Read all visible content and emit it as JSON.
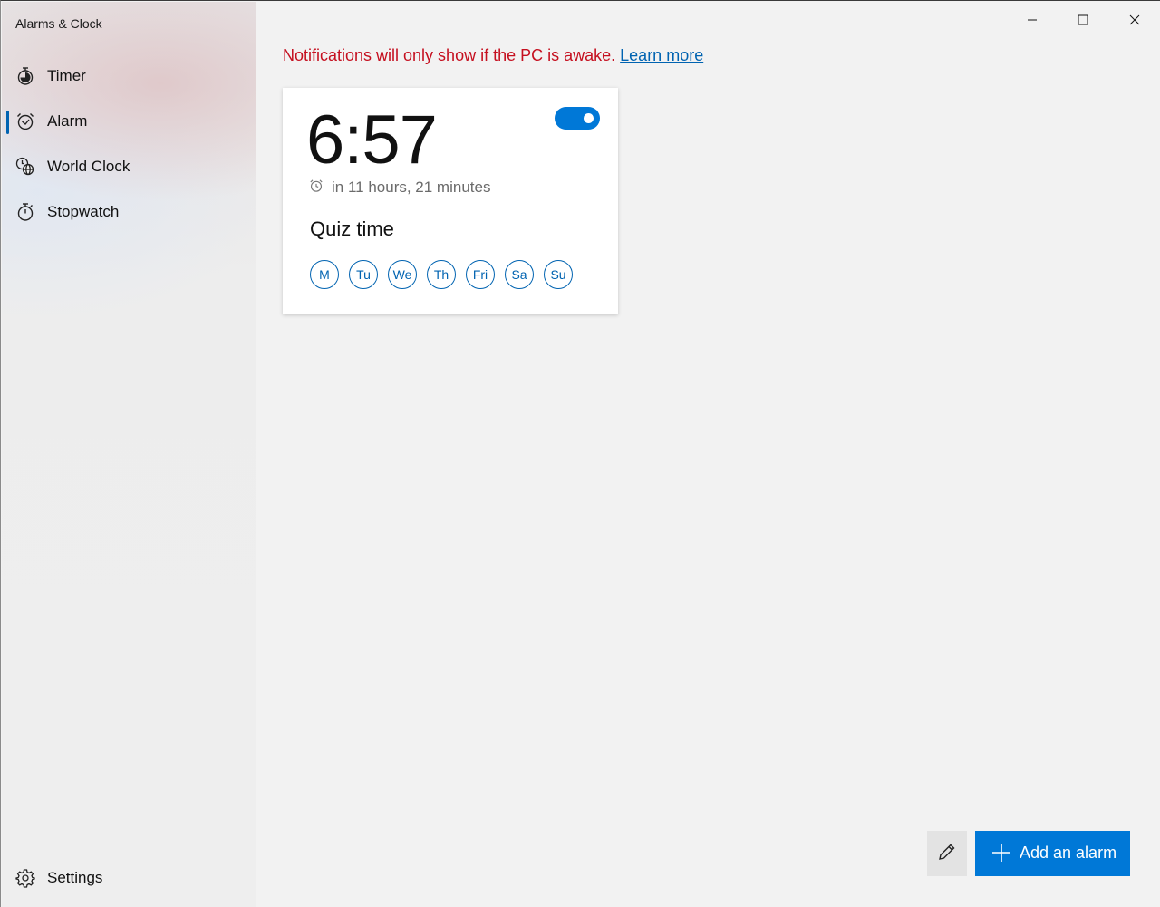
{
  "app": {
    "title": "Alarms & Clock"
  },
  "sidebar": {
    "items": [
      {
        "label": "Timer",
        "icon": "timer-icon",
        "selected": false
      },
      {
        "label": "Alarm",
        "icon": "alarm-clock-icon",
        "selected": true
      },
      {
        "label": "World Clock",
        "icon": "world-clock-icon",
        "selected": false
      },
      {
        "label": "Stopwatch",
        "icon": "stopwatch-icon",
        "selected": false
      }
    ],
    "settings": {
      "label": "Settings",
      "icon": "gear-icon"
    }
  },
  "window_controls": {
    "minimize": "minimize-icon",
    "maximize": "maximize-icon",
    "close": "close-icon"
  },
  "notice": {
    "text": "Notifications will only show if the PC is awake.",
    "link_text": "Learn more",
    "color": "#c50f1f"
  },
  "alarm": {
    "time": "6:57",
    "enabled": true,
    "remaining": "in 11 hours, 21 minutes",
    "name": "Quiz time",
    "days": [
      "M",
      "Tu",
      "We",
      "Th",
      "Fri",
      "Sa",
      "Su"
    ]
  },
  "actions": {
    "edit_icon": "pencil-icon",
    "add_label": "Add an alarm",
    "add_icon": "plus-icon"
  },
  "colors": {
    "accent": "#0078d7",
    "accent_dark": "#0063b1",
    "background": "#f2f2f2"
  }
}
